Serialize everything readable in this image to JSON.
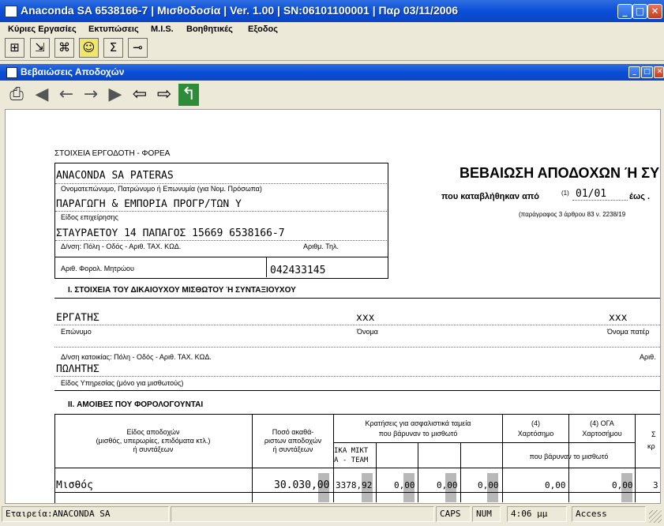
{
  "window": {
    "title": "Anaconda SA 6538166-7 | Μισθοδοσία | Ver. 1.00 | SN:06101100001 | Παρ 03/11/2006",
    "min_label": "_",
    "max_label": "□",
    "close_label": "✕"
  },
  "menu": [
    "Κύριες Εργασίες",
    "Εκτυπώσεις",
    "M.I.S.",
    "Βοηθητικές",
    "Εξοδος"
  ],
  "toolbar": {
    "icons": [
      {
        "name": "org-chart-icon",
        "glyph": "⊞"
      },
      {
        "name": "export-icon",
        "glyph": "⇲"
      },
      {
        "name": "network-icon",
        "glyph": "⌘"
      },
      {
        "name": "smiley-icon",
        "glyph": "☺"
      },
      {
        "name": "sigma-icon",
        "glyph": "Σ"
      },
      {
        "name": "key-icon",
        "glyph": "⊸"
      }
    ]
  },
  "child": {
    "title": "Βεβαιώσεις Αποδοχών",
    "nav_icons": [
      {
        "name": "print-icon",
        "glyph": "⎙"
      },
      {
        "name": "first-page-icon",
        "glyph": "◀"
      },
      {
        "name": "prev-page-icon",
        "glyph": "←"
      },
      {
        "name": "next-page-icon",
        "glyph": "→"
      },
      {
        "name": "last-page-icon",
        "glyph": "▶"
      },
      {
        "name": "back-arrow-icon",
        "glyph": "⇦"
      },
      {
        "name": "forward-arrow-icon",
        "glyph": "⇨"
      },
      {
        "name": "exit-icon",
        "glyph": "↰"
      }
    ]
  },
  "doc": {
    "employer_header": "ΣΤΟΙΧΕΙΑ ΕΡΓΟΔΟΤΗ - ΦΟΡΕΑ",
    "employer_name": "ANACONDA SA PATERAS",
    "employer_name_label": "Ονοματεπώνυμο, Πατρώνυμο ή Επωνυμία (για Νομ. Πρόσωπα)",
    "business": "ΠΑΡΑΓΩΓΗ & ΕΜΠΟΡΙΑ ΠΡΟΓΡ/ΤΩΝ Υ",
    "business_label": "Είδος επιχείρησης",
    "address": "ΣΤΑΥΡΑΕΤΟΥ 14 ΠΑΠΑΓΟΣ 15669 6538166-7",
    "address_label": "Δ/νση: Πόλη - Οδός - Αριθ. ΤΑΧ. ΚΩΔ.",
    "phone_label": "Αριθμ. Τηλ.",
    "register_label": "Αριθ. Φορολ. Μητρώου",
    "register_value": "042433145",
    "main_title": "ΒΕΒΑΙΩΣΗ ΑΠΟΔΟΧΩΝ Ή ΣΥ",
    "paid_from_label": "που καταβλήθηκαν από",
    "superscript": "(1)",
    "from_date": "01/01",
    "until_label": "έως .",
    "paragraph_note": "(παράγραφος 3 άρθρου 83 ν. 2238/19",
    "section1": "I.  ΣΤΟΙΧΕΙΑ ΤΟΥ ΔΙΚΑΙΟΥΧΟΥ ΜΙΣΘΩΤΟΥ Ή ΣΥΝΤΑΞΙΟΥΧΟΥ",
    "surname": "ΕΡΓΑΤΗΣ",
    "surname_label": "Επώνυμο",
    "firstname": "xxx",
    "firstname_label": "Όνομα",
    "father": "xxx",
    "father_label": "Όνομα πατέρ",
    "emp_address_label": "Δ/νση κατοικίας: Πόλη - Οδός - Αριθ. ΤΑΧ. ΚΩΔ.",
    "emp_address_right": "Αριθ.",
    "service": "ΠΩΛΗΤΗΣ",
    "service_label": "Είδος Υπηρεσίας (μόνο για μισθωτούς)",
    "section2": "II. ΑΜΟΙΒΕΣ ΠΟΥ ΦΟΡΟΛΟΓΟΥΝΤΑΙ",
    "col_kind": "Είδος αποδοχών\n(μισθός, υπερωρίες, επιδόματα κτλ.)\nή συντάξεων",
    "col_gross": "Ποσό ακαθά-\nριστων αποδοχών\nή συντάξεων",
    "col_deductions": "Κρατήσεις για ασφαλιστικά ταμεία\nπου βάρυναν το μισθωτό",
    "col_stamp": "(4)\nΧαρτόσημο",
    "col_oga": "(4) ΟΓΑ\nΧαρτοσήμου",
    "col_burdened": "που βάρυναν το μισθωτό",
    "col_sigma": "Σ",
    "col_kr": "κρ",
    "ika_label_1": "ΙΚΑ ΜΙΚΤ",
    "ika_label_2": "Α - TEAM",
    "row_label": "Μισθός",
    "row_gross": "30.030,00",
    "row_ika": "3378,92",
    "row_z1": "0,00",
    "row_z2": "0,00",
    "row_z3": "0,00",
    "row_stamp": "0,00",
    "row_oga": "0,00",
    "row_last": "3"
  },
  "status": {
    "company": "Εταιρεία:ANACONDA SA",
    "caps": "CAPS",
    "num": "NUM",
    "time": "4:06 μμ",
    "app": "Access"
  }
}
